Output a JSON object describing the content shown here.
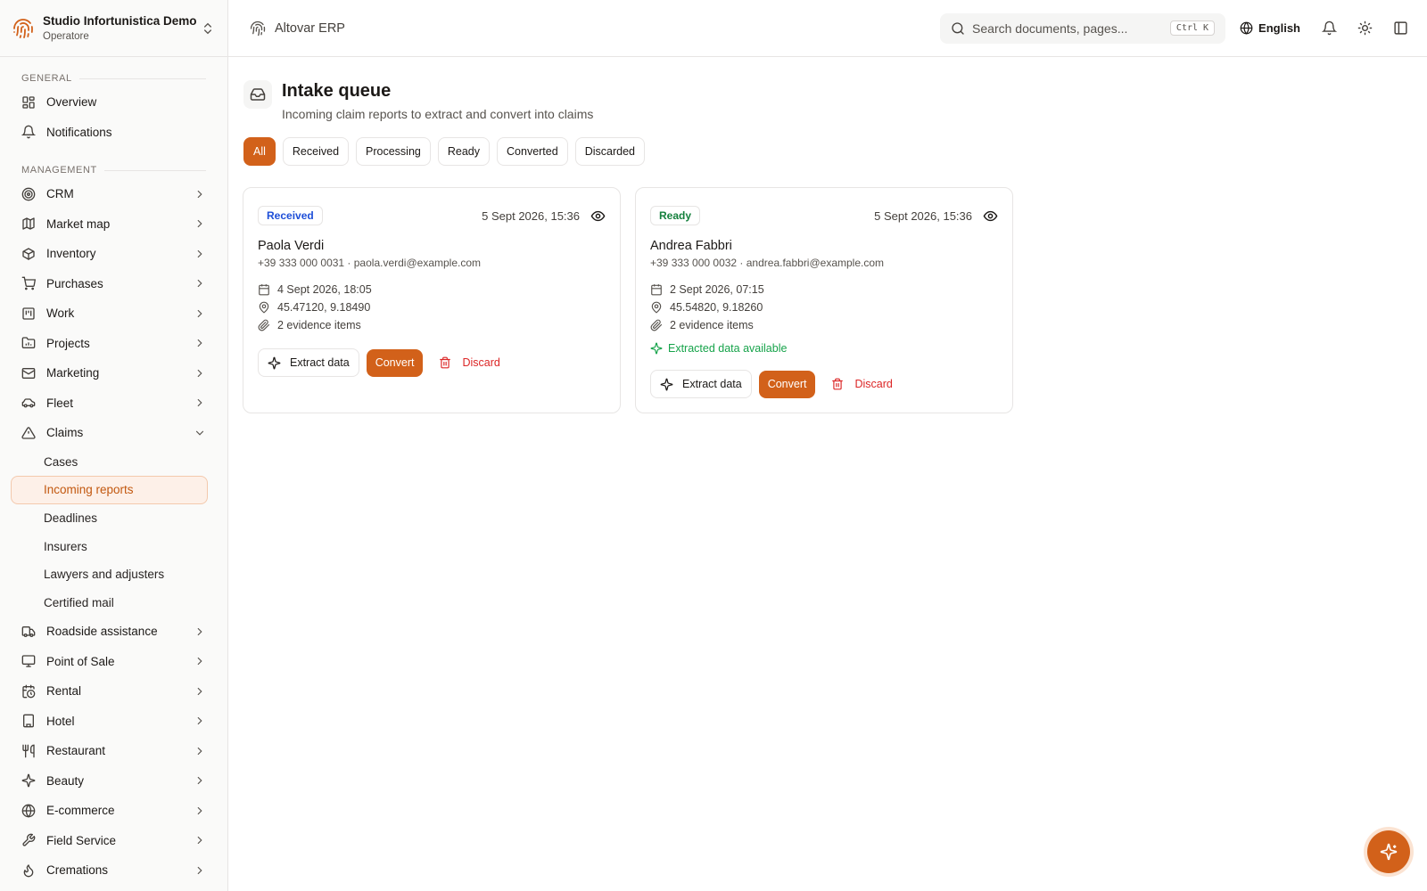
{
  "org": {
    "name": "Studio Infortunistica Demo",
    "role": "Operatore"
  },
  "header": {
    "app_title": "Altovar ERP",
    "search_placeholder": "Search documents, pages...",
    "search_shortcut": "Ctrl K",
    "language": "English"
  },
  "sidebar": {
    "general_label": "GENERAL",
    "general": [
      {
        "label": "Overview",
        "icon": "grid-icon"
      },
      {
        "label": "Notifications",
        "icon": "bell-icon"
      }
    ],
    "management_label": "MANAGEMENT",
    "management_top": [
      {
        "label": "CRM",
        "icon": "target-icon"
      },
      {
        "label": "Market map",
        "icon": "map-icon"
      },
      {
        "label": "Inventory",
        "icon": "box-icon"
      },
      {
        "label": "Purchases",
        "icon": "cart-icon"
      },
      {
        "label": "Work",
        "icon": "kanban-icon"
      },
      {
        "label": "Projects",
        "icon": "folder-chart-icon"
      },
      {
        "label": "Marketing",
        "icon": "mail-icon"
      },
      {
        "label": "Fleet",
        "icon": "car-icon"
      }
    ],
    "claims": {
      "label": "Claims",
      "items": [
        {
          "label": "Cases",
          "active": false
        },
        {
          "label": "Incoming reports",
          "active": true
        },
        {
          "label": "Deadlines",
          "active": false
        },
        {
          "label": "Insurers",
          "active": false
        },
        {
          "label": "Lawyers and adjusters",
          "active": false
        },
        {
          "label": "Certified mail",
          "active": false
        }
      ]
    },
    "management_bottom": [
      {
        "label": "Roadside assistance",
        "icon": "truck-icon"
      },
      {
        "label": "Point of Sale",
        "icon": "monitor-icon"
      },
      {
        "label": "Rental",
        "icon": "calendar-clock-icon"
      },
      {
        "label": "Hotel",
        "icon": "building-icon"
      },
      {
        "label": "Restaurant",
        "icon": "utensils-icon"
      },
      {
        "label": "Beauty",
        "icon": "sparkles-icon"
      },
      {
        "label": "E-commerce",
        "icon": "globe-icon"
      },
      {
        "label": "Field Service",
        "icon": "wrench-icon"
      },
      {
        "label": "Cremations",
        "icon": "flame-icon"
      }
    ]
  },
  "page": {
    "title": "Intake queue",
    "subtitle": "Incoming claim reports to extract and convert into claims",
    "tabs": [
      {
        "label": "All",
        "active": true
      },
      {
        "label": "Received",
        "active": false
      },
      {
        "label": "Processing",
        "active": false
      },
      {
        "label": "Ready",
        "active": false
      },
      {
        "label": "Converted",
        "active": false
      },
      {
        "label": "Discarded",
        "active": false
      }
    ]
  },
  "actions": {
    "extract": "Extract data",
    "convert": "Convert",
    "discard": "Discard"
  },
  "cards": [
    {
      "status": "Received",
      "status_kind": "received",
      "received_at": "5 Sept 2026, 15:36",
      "name": "Paola Verdi",
      "contact": "+39 333 000 0031 · paola.verdi@example.com",
      "event_date": "4 Sept 2026, 18:05",
      "coords": "45.47120, 9.18490",
      "evidence": "2 evidence items",
      "extracted": ""
    },
    {
      "status": "Ready",
      "status_kind": "ready",
      "received_at": "5 Sept 2026, 15:36",
      "name": "Andrea Fabbri",
      "contact": "+39 333 000 0032 · andrea.fabbri@example.com",
      "event_date": "2 Sept 2026, 07:15",
      "coords": "45.54820, 9.18260",
      "evidence": "2 evidence items",
      "extracted": "Extracted data available"
    }
  ],
  "colors": {
    "accent": "#d2611a",
    "danger": "#dc2626",
    "success": "#16a34a",
    "info": "#1d4ed8"
  }
}
